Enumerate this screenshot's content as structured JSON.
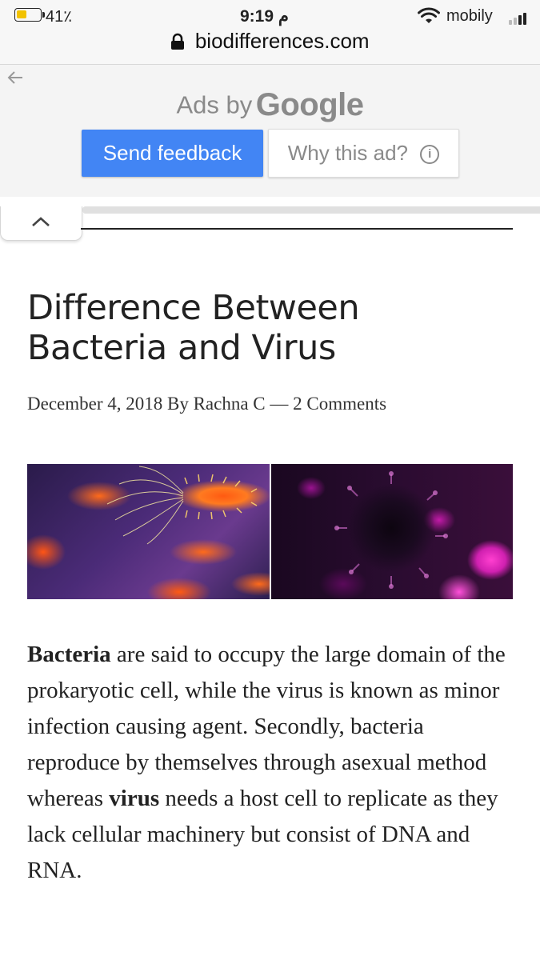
{
  "status_bar": {
    "battery_percent": "41٪",
    "battery_level": 0.41,
    "time": "9:19 م",
    "carrier": "mobily"
  },
  "browser": {
    "url": "biodifferences.com"
  },
  "ad": {
    "ads_by": "Ads by",
    "google": "Google",
    "send_feedback": "Send feedback",
    "why_this_ad": "Why this ad?",
    "accent_color": "#4285f4"
  },
  "article": {
    "title": "Difference Between Bacteria and Virus",
    "date": "December 4, 2018",
    "by": "By",
    "author": "Rachna C",
    "dash": "—",
    "comments": "2 Comments",
    "image_alt_left": "Bacteria",
    "image_alt_right": "Virus",
    "para": {
      "bacteria_bold": "Bacteria",
      "part1": " are said to occupy the large domain of the prokaryotic cell, while the virus is known as minor infection causing agent. Secondly, bacteria reproduce by themselves through asexual method whereas ",
      "virus_bold": "virus",
      "part2": " needs a host cell to replicate as they lack cellular machinery but consist of DNA and RNA."
    }
  },
  "icons": [
    "battery-icon",
    "wifi-icon",
    "signal-icon",
    "lock-icon",
    "back-arrow-icon",
    "info-icon",
    "chevron-up-icon"
  ]
}
